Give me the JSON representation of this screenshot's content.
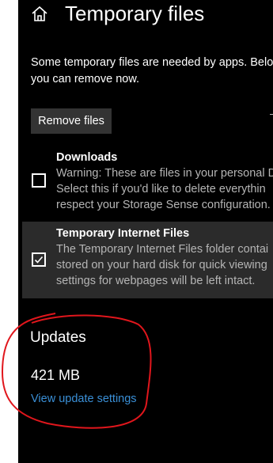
{
  "header": {
    "title": "Temporary files",
    "home_icon": "home-icon"
  },
  "intro": {
    "line1": "Some temporary files are needed by apps. Belo",
    "line2": "you can remove now."
  },
  "toolbar": {
    "remove_label": "Remove files"
  },
  "items": [
    {
      "title": "Downloads",
      "checked": false,
      "desc": [
        "Warning: These are files in your personal D",
        "Select this if you'd like to delete everythin",
        "respect your Storage Sense configuration."
      ]
    },
    {
      "title": "Temporary Internet Files",
      "checked": true,
      "desc": [
        "The Temporary Internet Files folder contai",
        "stored on your hard disk for quick viewing",
        "settings for webpages will be left intact."
      ]
    }
  ],
  "updates": {
    "heading": "Updates",
    "size": "421 MB",
    "link": "View update settings"
  },
  "colors": {
    "background": "#000000",
    "selected_item": "#2b2b2b",
    "button": "#333333",
    "link": "#3a8fd6",
    "annotation": "#e0161c"
  }
}
